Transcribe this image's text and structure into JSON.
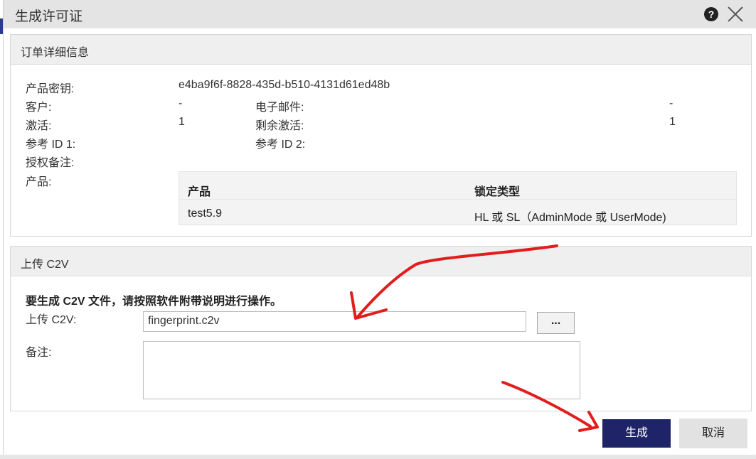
{
  "dialog": {
    "title": "生成许可证"
  },
  "order": {
    "heading": "订单详细信息",
    "product_key_label": "产品密钥:",
    "product_key_value": "e4ba9f6f-8828-435d-b510-4131d61ed48b",
    "customer_label": "客户:",
    "customer_value": "-",
    "email_label": "电子邮件:",
    "email_value": "-",
    "activations_label": "激活:",
    "activations_value": "1",
    "remaining_label": "剩余激活:",
    "remaining_value": "1",
    "ref1_label": "参考 ID 1:",
    "ref2_label": "参考 ID 2:",
    "auth_notes_label": "授权备注:",
    "product_label": "产品:",
    "table": {
      "headers": [
        "产品",
        "锁定类型"
      ],
      "rows": [
        [
          "test5.9",
          "HL 或 SL（AdminMode 或 UserMode)"
        ]
      ]
    }
  },
  "upload": {
    "heading": "上传 C2V",
    "instruction": "要生成 C2V 文件，请按照软件附带说明进行操作。",
    "file_label": "上传 C2V:",
    "file_value": "fingerprint.c2v",
    "browse_label": "...",
    "notes_label": "备注:"
  },
  "buttons": {
    "generate": "生成",
    "cancel": "取消"
  },
  "colors": {
    "primary": "#1f2468",
    "annotation": "#e11d1d"
  }
}
